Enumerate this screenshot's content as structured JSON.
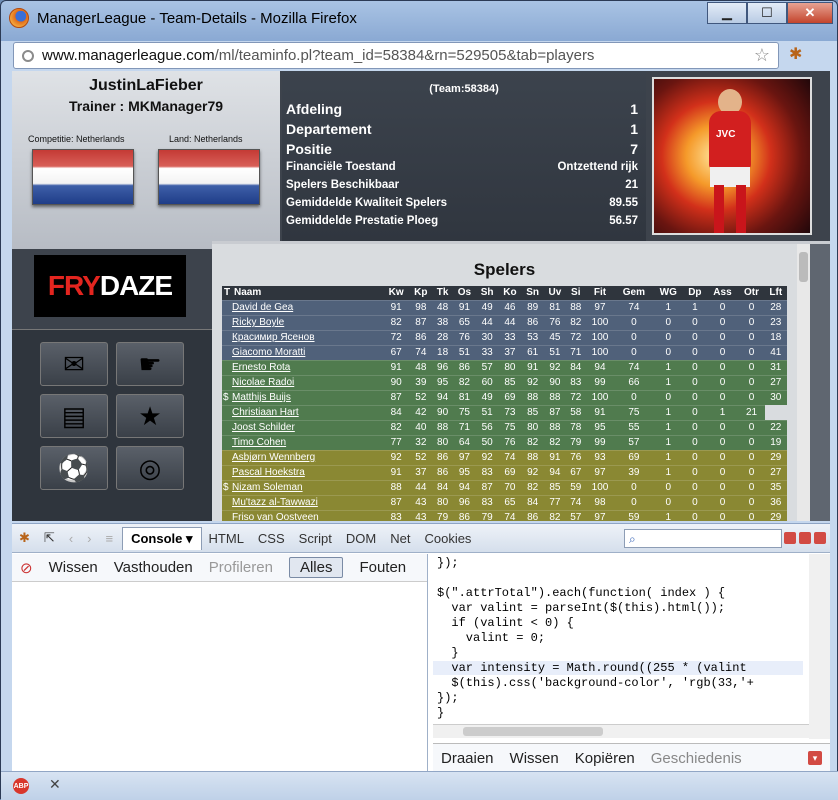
{
  "window": {
    "title": "ManagerLeague - Team-Details - Mozilla Firefox"
  },
  "url": {
    "domain": "www.managerleague.com",
    "path": "/ml/teaminfo.pl?team_id=58384&rn=529505&tab=players"
  },
  "team": {
    "name": "JustinLaFieber",
    "trainer": "Trainer : MKManager79",
    "competition_label": "Competitie: Netherlands",
    "country_label": "Land: Netherlands",
    "team_id": "(Team:58384)"
  },
  "stats": [
    {
      "label": "Afdeling",
      "value": "1"
    },
    {
      "label": "Departement",
      "value": "1"
    },
    {
      "label": "Positie",
      "value": "7"
    },
    {
      "label": "Financiële Toestand",
      "value": "Ontzettend rijk"
    },
    {
      "label": "Spelers Beschikbaar",
      "value": "21"
    },
    {
      "label": "Gemiddelde Kwaliteit Spelers",
      "value": "89.55"
    },
    {
      "label": "Gemiddelde Prestatie Ploeg",
      "value": "56.57"
    }
  ],
  "sponsor": {
    "part1": "FRY",
    "part2": "DAZE"
  },
  "photo_text": "JVC",
  "spelers": {
    "title": "Spelers",
    "columns": [
      "T",
      "Naam",
      "Kw",
      "Kp",
      "Tk",
      "Os",
      "Sh",
      "Ko",
      "Sn",
      "Uv",
      "Si",
      "Fit",
      "Gem",
      "WG",
      "Dp",
      "Ass",
      "Otr",
      "Lft"
    ],
    "rows": [
      {
        "pos": "k",
        "t": "",
        "name": "David de Gea",
        "v": [
          "91",
          "98",
          "48",
          "91",
          "49",
          "46",
          "89",
          "81",
          "88",
          "97",
          "74",
          "1",
          "1",
          "0",
          "0",
          "28"
        ]
      },
      {
        "pos": "k",
        "t": "",
        "name": "Ricky Boyle",
        "v": [
          "82",
          "87",
          "38",
          "65",
          "44",
          "44",
          "86",
          "76",
          "82",
          "100",
          "0",
          "0",
          "0",
          "0",
          "0",
          "23"
        ]
      },
      {
        "pos": "k",
        "t": "",
        "name": "Красимир Ясенов",
        "v": [
          "72",
          "86",
          "28",
          "76",
          "30",
          "33",
          "53",
          "45",
          "72",
          "100",
          "0",
          "0",
          "0",
          "0",
          "0",
          "18"
        ]
      },
      {
        "pos": "k",
        "t": "",
        "name": "Giacomo Moratti",
        "v": [
          "67",
          "74",
          "18",
          "51",
          "33",
          "37",
          "61",
          "51",
          "71",
          "100",
          "0",
          "0",
          "0",
          "0",
          "0",
          "41"
        ]
      },
      {
        "pos": "d",
        "t": "",
        "name": "Ernesto Rota",
        "v": [
          "91",
          "48",
          "96",
          "86",
          "57",
          "80",
          "91",
          "92",
          "84",
          "94",
          "74",
          "1",
          "0",
          "0",
          "0",
          "31"
        ]
      },
      {
        "pos": "d",
        "t": "",
        "name": "Nicolae Radoi",
        "v": [
          "90",
          "39",
          "95",
          "82",
          "60",
          "85",
          "92",
          "90",
          "83",
          "99",
          "66",
          "1",
          "0",
          "0",
          "0",
          "27"
        ]
      },
      {
        "pos": "d",
        "t": "$",
        "name": "Matthijs Buijs",
        "v": [
          "87",
          "52",
          "94",
          "81",
          "49",
          "69",
          "88",
          "88",
          "72",
          "100",
          "0",
          "0",
          "0",
          "0",
          "0",
          "30"
        ]
      },
      {
        "pos": "d",
        "t": "",
        "name": "Christiaan Hart",
        "v": [
          "84",
          "42",
          "90",
          "75",
          "51",
          "73",
          "85",
          "87",
          "58",
          "91",
          "75",
          "1",
          "0",
          "1",
          "21"
        ]
      },
      {
        "pos": "d",
        "t": "",
        "name": "Joost Schilder",
        "v": [
          "82",
          "40",
          "88",
          "71",
          "56",
          "75",
          "80",
          "88",
          "78",
          "95",
          "55",
          "1",
          "0",
          "0",
          "0",
          "22"
        ]
      },
      {
        "pos": "d",
        "t": "",
        "name": "Timo Cohen",
        "v": [
          "77",
          "32",
          "80",
          "64",
          "50",
          "76",
          "82",
          "82",
          "79",
          "99",
          "57",
          "1",
          "0",
          "0",
          "0",
          "19"
        ]
      },
      {
        "pos": "m",
        "t": "",
        "name": "Asbjørn Wennberg",
        "v": [
          "92",
          "52",
          "86",
          "97",
          "92",
          "74",
          "88",
          "91",
          "76",
          "93",
          "69",
          "1",
          "0",
          "0",
          "0",
          "29"
        ]
      },
      {
        "pos": "m",
        "t": "",
        "name": "Pascal Hoekstra",
        "v": [
          "91",
          "37",
          "86",
          "95",
          "83",
          "69",
          "92",
          "94",
          "67",
          "97",
          "39",
          "1",
          "0",
          "0",
          "0",
          "27"
        ]
      },
      {
        "pos": "m",
        "t": "$",
        "name": "Nizam Soleman",
        "v": [
          "88",
          "44",
          "84",
          "94",
          "87",
          "70",
          "82",
          "85",
          "59",
          "100",
          "0",
          "0",
          "0",
          "0",
          "0",
          "35"
        ]
      },
      {
        "pos": "m",
        "t": "",
        "name": "Mu'tazz al-Tawwazi",
        "v": [
          "87",
          "43",
          "80",
          "96",
          "83",
          "65",
          "84",
          "77",
          "74",
          "98",
          "0",
          "0",
          "0",
          "0",
          "0",
          "36"
        ]
      },
      {
        "pos": "m",
        "t": "",
        "name": "Friso van Oostveen",
        "v": [
          "83",
          "43",
          "79",
          "86",
          "79",
          "74",
          "86",
          "82",
          "57",
          "97",
          "59",
          "1",
          "0",
          "0",
          "0",
          "29"
        ]
      }
    ]
  },
  "firebug": {
    "tabs": [
      "Console",
      "HTML",
      "CSS",
      "Script",
      "DOM",
      "Net",
      "Cookies"
    ],
    "log_buttons": [
      "Wissen",
      "Vasthouden",
      "Profileren",
      "Alles",
      "Fouten"
    ],
    "code_lines": [
      "});",
      "",
      "$(\".attrTotal\").each(function( index ) {",
      "  var valint = parseInt($(this).html());",
      "  if (valint < 0) {",
      "    valint = 0;",
      "  }",
      "  var intensity = Math.round((255 * (valint",
      "  $(this).css('background-color', 'rgb(33,'+",
      "});",
      "}"
    ],
    "run_buttons": [
      "Draaien",
      "Wissen",
      "Kopiëren",
      "Geschiedenis"
    ]
  },
  "statusbar": {
    "abp_label": "ABP"
  }
}
